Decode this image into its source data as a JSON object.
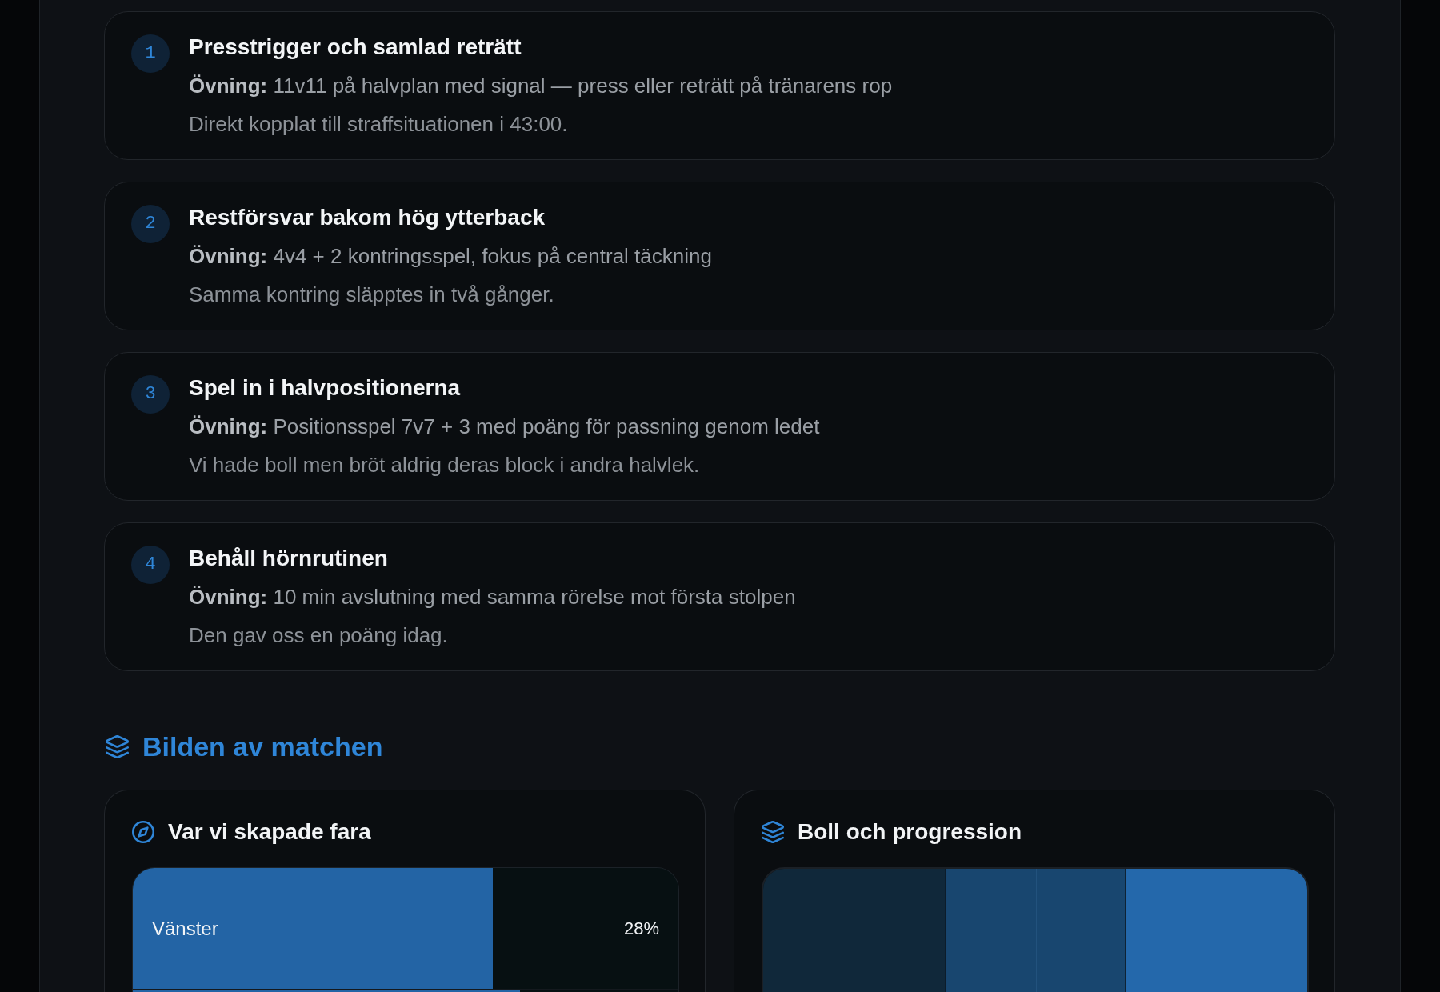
{
  "focus_list": [
    {
      "number": "1",
      "title": "Presstrigger och samlad reträtt",
      "exercise": "**Övning:** 11v11 på halvplan med signal — press eller reträtt på tränarens rop",
      "note": "Direkt kopplat till straffsituationen i 43:00."
    },
    {
      "number": "2",
      "title": "Restförsvar bakom hög ytterback",
      "exercise": "**Övning:** 4v4 + 2 kontringsspel, fokus på central täckning",
      "note": "Samma kontring släpptes in två gånger."
    },
    {
      "number": "3",
      "title": "Spel in i halvpositionerna",
      "exercise": "**Övning:** Positionsspel 7v7 + 3 med poäng för passning genom ledet",
      "note": "Vi hade boll men bröt aldrig deras block i andra halvlek."
    },
    {
      "number": "4",
      "title": "Behåll hörnrutinen",
      "exercise": "**Övning:** 10 min avslutning med samma rörelse mot första stolpen",
      "note": "Den gav oss en poäng idag."
    }
  ],
  "section": {
    "title": "Bilden av matchen"
  },
  "panels": [
    {
      "kind": "zones",
      "title": "Var vi skapade fara",
      "zones": [
        {
          "label": "Vänster",
          "reading": "28%",
          "level": 0.66
        },
        {
          "level": 0.71
        }
      ]
    },
    {
      "kind": "progression",
      "title": "Boll och progression"
    }
  ]
}
